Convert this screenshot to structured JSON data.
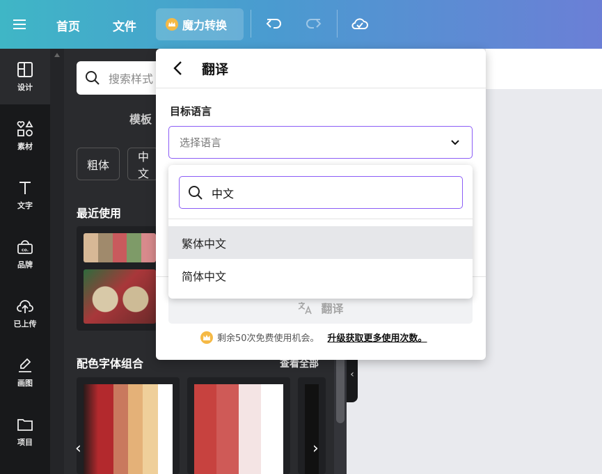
{
  "topbar": {
    "nav_home": "首页",
    "nav_file": "文件",
    "magic_label": "魔力转换",
    "icons": [
      "menu-icon",
      "crown-icon",
      "undo-icon",
      "redo-icon",
      "cloud-sync-icon"
    ]
  },
  "rail": {
    "items": [
      {
        "label": "设计",
        "icon": "layout-icon"
      },
      {
        "label": "素材",
        "icon": "elements-icon"
      },
      {
        "label": "文字",
        "icon": "text-icon"
      },
      {
        "label": "品牌",
        "icon": "brand-icon"
      },
      {
        "label": "已上传",
        "icon": "upload-icon"
      },
      {
        "label": "画图",
        "icon": "draw-icon"
      },
      {
        "label": "项目",
        "icon": "folder-icon"
      }
    ]
  },
  "panel": {
    "search_placeholder": "搜索样式",
    "tab_label": "模板",
    "chips": [
      "粗体",
      "中文"
    ],
    "recent_title": "最近使用",
    "combo_title": "配色字体组合",
    "combo_link": "查看全部",
    "pager_prev": "‹",
    "pager_next": "›",
    "collapse": "‹",
    "palette_colors": [
      "#d7b896",
      "#a08a6c",
      "#c95a5d",
      "#7e9b68",
      "#d88a8c"
    ],
    "combo1_colors": [
      "#b3292d",
      "#c9795e",
      "#e4b178",
      "#efcf9a",
      "#ffffff"
    ],
    "combo2_colors": [
      "#c7423f",
      "#cf5a57",
      "#f4e4e4",
      "#ffffff"
    ]
  },
  "popover": {
    "title": "翻译",
    "target_label": "目标语言",
    "select_placeholder": "选择语言",
    "translate_button": "翻译",
    "quota_text": "剩余50次免费使用机会。",
    "upgrade_link": "升级获取更多使用次数。",
    "accent": "#8b5cf6"
  },
  "dropdown": {
    "search_value": "中文",
    "options": [
      "繁体中文",
      "简体中文"
    ],
    "hovered_index": 0
  }
}
